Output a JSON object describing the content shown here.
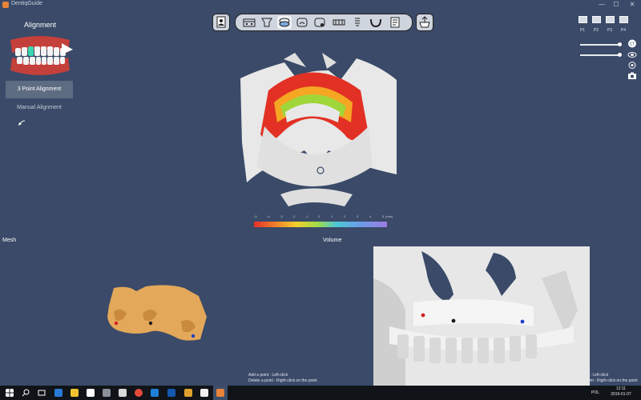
{
  "window": {
    "title": "DentiqGuide",
    "min_glyph": "—",
    "max_glyph": "☐",
    "close_glyph": "✕"
  },
  "left_panel": {
    "title": "Alignment",
    "methods": [
      "3 Point Alignment",
      "Manual Alignment"
    ],
    "active_method": "3 Point Alignment"
  },
  "toolbar": {
    "icons": [
      "patient-info-icon",
      "implant-icon",
      "alignment-icon",
      "crown-icon",
      "sleeve-icon",
      "guide-icon",
      "bar-icon",
      "arch-icon",
      "report-icon"
    ],
    "active_icon": "alignment-icon",
    "export_icon": "export-icon"
  },
  "views": {
    "labels": [
      "P1",
      "P2",
      "P3",
      "P4"
    ]
  },
  "sliders": [
    {
      "level": 0.98
    },
    {
      "level": 0.98
    }
  ],
  "side_tools": [
    "ct-icon",
    "tooth-view-icon",
    "rotate-icon",
    "camera-icon"
  ],
  "side_ct_label": "CT",
  "panes": {
    "mesh": {
      "label": "Mesh",
      "hint_lines": [
        "Add a point : Left-click",
        "Delete a point : Right-click on the point"
      ]
    },
    "volume": {
      "label": "Volume",
      "hint_lines": [
        "Add a point : Left-click",
        "Delete a point : Right-click on the point"
      ]
    }
  },
  "color_scale": {
    "ticks": [
      "-5",
      "-4",
      "-3",
      "-2",
      "-1",
      "0",
      "1",
      "2",
      "3",
      "4",
      "5"
    ],
    "unit": "(mm)"
  },
  "colors": {
    "background": "#3a4a68",
    "active_button": "#5e6c82",
    "bone": "#e8e8e8",
    "mesh": "#e3a85a"
  },
  "points": {
    "colors": [
      "#d42020",
      "#1a1a1a",
      "#2040c8"
    ]
  },
  "taskbar": {
    "icons": [
      "start-icon",
      "search-icon",
      "task-view-icon",
      "edge-icon",
      "file-explorer-icon",
      "store-icon",
      "settings-icon",
      "chrome-icon",
      "mail-icon",
      "outlook-icon",
      "paint-icon",
      "mail2-icon",
      "dentiq-icon"
    ],
    "language": "POL",
    "time": "12:11",
    "date": "2019-01-07"
  }
}
